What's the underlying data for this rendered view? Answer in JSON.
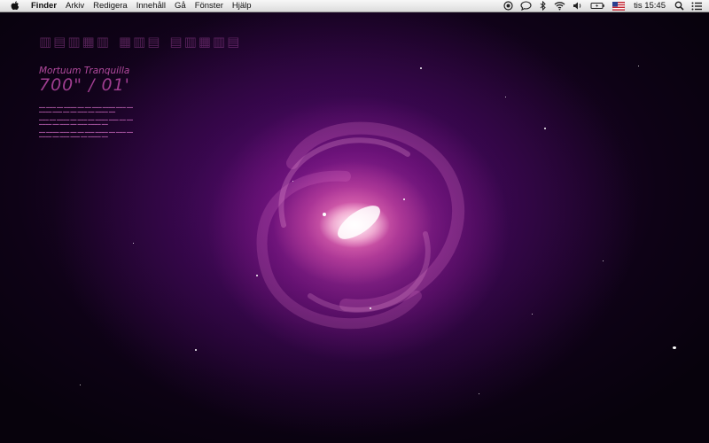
{
  "menubar": {
    "apple_icon": "apple-icon",
    "app_name": "Finder",
    "items": [
      "Arkiv",
      "Redigera",
      "Innehåll",
      "Gå",
      "Fönster",
      "Hjälp"
    ],
    "status_icons": [
      "time-machine-icon",
      "chat-icon",
      "bluetooth-icon",
      "wifi-icon",
      "volume-icon",
      "battery-icon",
      "us-flag-icon",
      "spotlight-icon",
      "notification-list-icon"
    ],
    "clock": "tis 15:45"
  },
  "widget": {
    "title": "Mortuum Tranquilla",
    "coords": "700\" / 01'"
  },
  "colors": {
    "accent": "#a2408f",
    "galaxy_core": "#ff9cc8",
    "nebula": "#7a1a96",
    "background": "#07020c"
  }
}
